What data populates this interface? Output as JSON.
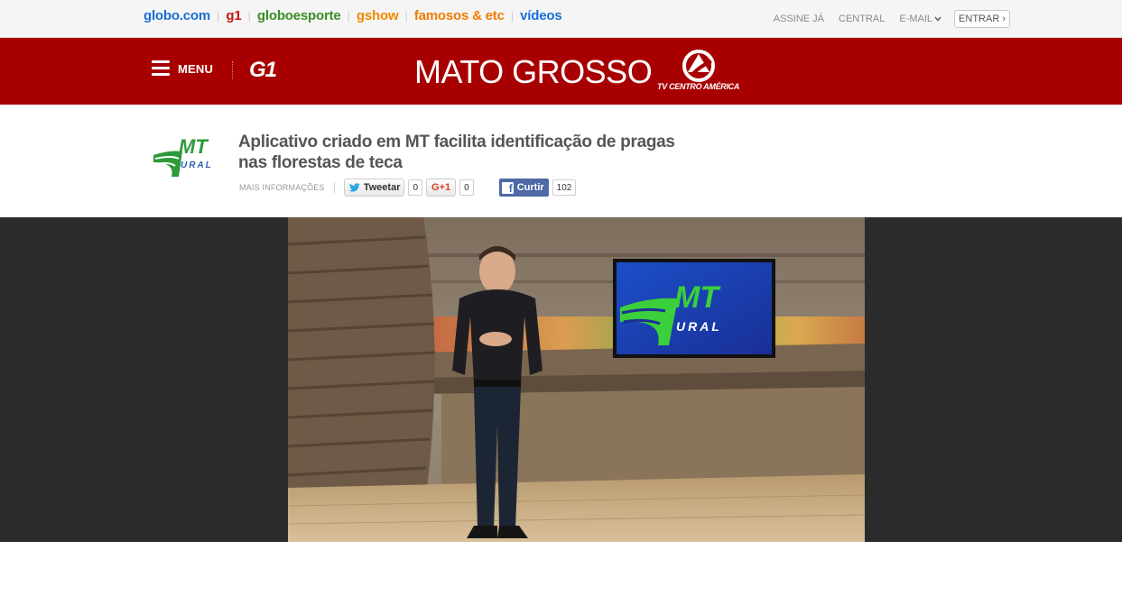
{
  "globobar": {
    "brands": [
      {
        "label": "globo.com",
        "color": "#1a6ed8"
      },
      {
        "label": "g1",
        "color": "#c4170c"
      },
      {
        "label": "globoesporte",
        "color": "#3a8f25"
      },
      {
        "label": "gshow",
        "color": "#f08a00"
      },
      {
        "label": "famosos & etc",
        "color": "#f07c00"
      },
      {
        "label": "vídeos",
        "color": "#1a6ed8"
      }
    ],
    "links": {
      "assine": "ASSINE JÁ",
      "central": "CENTRAL",
      "email": "E-MAIL",
      "entrar": "ENTRAR ›"
    }
  },
  "header": {
    "menu_label": "MENU",
    "g1_label": "G1",
    "region": "MATO GROSSO",
    "tv_label": "TV CENTRO AMÉRICA",
    "bg_color": "#a80000"
  },
  "article": {
    "program_logo": "MT RURAL",
    "headline": "Aplicativo criado em MT facilita identificação de pragas nas florestas de teca",
    "more_info": "MAIS INFORMAÇÕES",
    "twitter": {
      "label": "Tweetar",
      "count": "0"
    },
    "gplus": {
      "label": "G+1",
      "count": "0"
    },
    "facebook": {
      "label": "Curtir",
      "count": "102"
    }
  },
  "video": {
    "screen_logo": "MT RURAL"
  }
}
